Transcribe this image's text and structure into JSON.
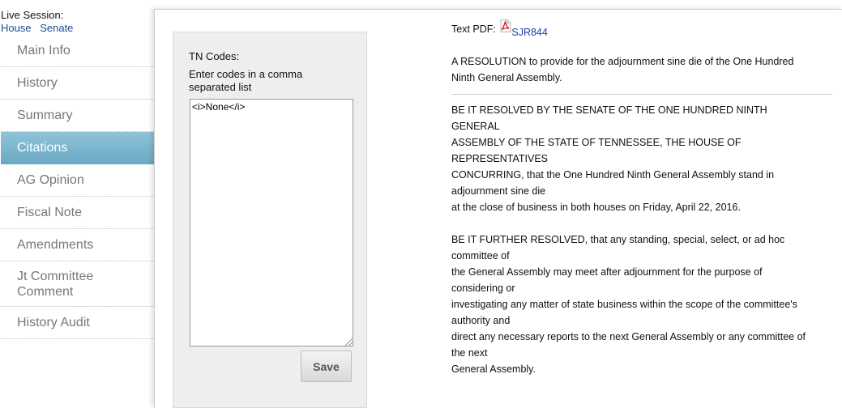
{
  "live_session": {
    "label": "Live Session:",
    "links": [
      "House",
      "Senate"
    ]
  },
  "sidebar": {
    "items": [
      {
        "label": "Main Info"
      },
      {
        "label": "History"
      },
      {
        "label": "Summary"
      },
      {
        "label": "Citations",
        "active": true
      },
      {
        "label": "AG Opinion"
      },
      {
        "label": "Fiscal Note"
      },
      {
        "label": "Amendments"
      },
      {
        "label": "Jt Committee Comment"
      },
      {
        "label": "History Audit"
      }
    ]
  },
  "codes": {
    "title": "TN Codes:",
    "instructions": "Enter codes in a comma separated list",
    "value": "<i>None</i>",
    "save_label": "Save"
  },
  "document": {
    "pdf_label": "Text PDF:",
    "pdf_link": "SJR844",
    "pdf_icon": "pdf-file-icon",
    "summary_lines": [
      "A RESOLUTION to provide for the adjournment sine die of the One Hundred",
      "Ninth General Assembly."
    ],
    "body_lines": [
      "BE IT RESOLVED BY THE SENATE OF THE ONE HUNDRED NINTH",
      "GENERAL",
      "ASSEMBLY OF THE STATE OF TENNESSEE, THE HOUSE OF",
      "REPRESENTATIVES",
      "CONCURRING, that the One Hundred Ninth General Assembly stand in",
      "adjournment sine die",
      "at the close of business in both houses on Friday, April 22, 2016.",
      "",
      "BE IT FURTHER RESOLVED, that any standing, special, select, or ad hoc",
      "committee of",
      "the General Assembly may meet after adjournment for the purpose of",
      "considering or",
      "investigating any matter of state business within the scope of the committee's",
      "authority and",
      "direct any necessary reports to the next General Assembly or any committee of",
      "the next",
      "General Assembly."
    ]
  },
  "colors": {
    "active_nav": "#7fb8cf",
    "link": "#1a4b8c"
  }
}
